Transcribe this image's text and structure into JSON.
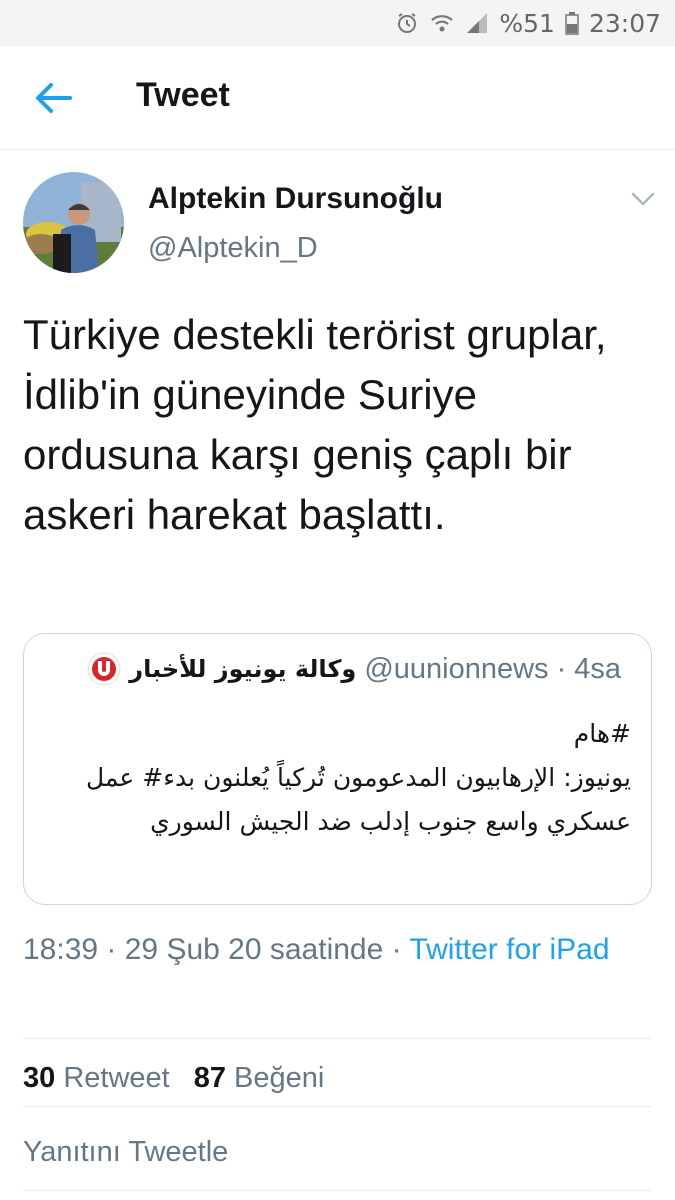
{
  "status_bar": {
    "battery": "%51",
    "time": "23:07",
    "icons": [
      "alarm-icon",
      "wifi-icon",
      "signal-icon",
      "battery-icon"
    ]
  },
  "header": {
    "title": "Tweet",
    "back_icon": "back-arrow-icon"
  },
  "tweet": {
    "author_name": "Alptekin Dursunoğlu",
    "author_handle": "@Alptekin_D",
    "text": "Türkiye destekli terörist gruplar, İdlib'in güneyinde Suriye ordusuna karşı geniş çaplı bir askeri harekat başlattı.",
    "time": "18:39",
    "date_text": "29 Şub 20 saatinde",
    "source": "Twitter for iPad"
  },
  "quoted_tweet": {
    "name": "وكالة يونيوز للأخبار",
    "handle": "@uunionnews",
    "age": "4sa",
    "line1": "#هام",
    "body": "يونيوز: الإرهابيون المدعومون تُركياً يُعلنون بدء# عمل عسكري واسع جنوب إدلب ضد الجيش السوري"
  },
  "stats": {
    "retweets_count": "30",
    "retweets_label": "Retweet",
    "likes_count": "87",
    "likes_label": "Beğeni"
  },
  "reply": {
    "placeholder": "Yanıtını Tweetle"
  },
  "colors": {
    "accent": "#1da1f2",
    "secondary_text": "#657786",
    "divider": "#e6ecf0"
  }
}
